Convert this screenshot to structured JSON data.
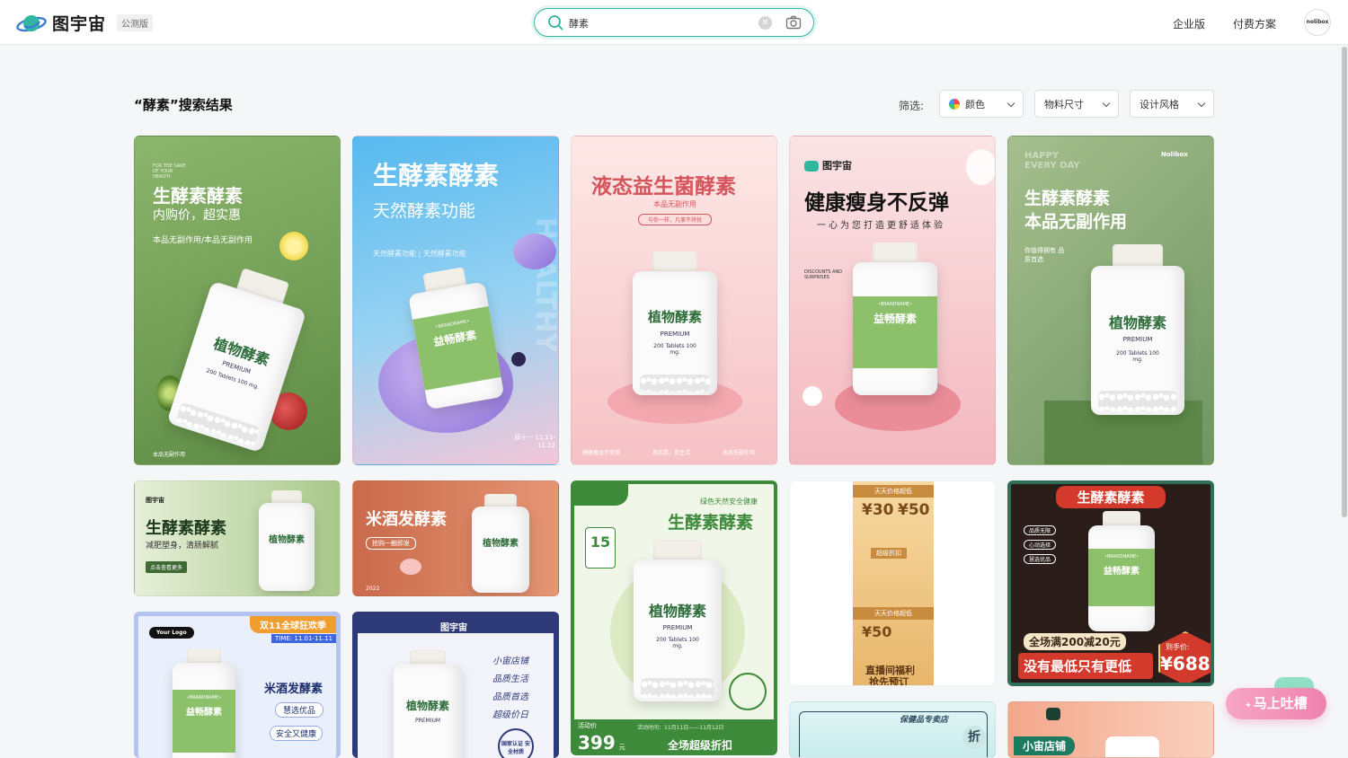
{
  "header": {
    "logo_text": "图宇宙",
    "beta_label": "公测版",
    "search_value": "酵素",
    "nav": [
      "企业版",
      "付费方案"
    ],
    "avatar_text": "nolibox"
  },
  "results": {
    "title": "“酵素”搜索结果",
    "filter_label": "筛选:",
    "filters": [
      "颜色",
      "物料尺寸",
      "设计风格"
    ]
  },
  "feedback_label": "马上吐槽",
  "cards": {
    "c1": {
      "tag": "FOR THE SAKE OF YOUR HEALTH",
      "title": "生酵素酵素",
      "sub": "内购价，超实惠",
      "line": "本品无副作用/本品无副作用",
      "label": "植物酵素",
      "premium": "PREMIUM",
      "tabs": "200 Tablets 100 mg.",
      "footer": "本品无副作用"
    },
    "c2": {
      "title": "生酵素酵素",
      "sub": "天然酵素功能",
      "line": "天然酵素功能 | 天然酵素功能",
      "side": "HEALTHY",
      "brand": "•BRANDNAME•",
      "label": "益畅酵素",
      "date": "双十一 11.11-11.12"
    },
    "c3": {
      "title": "液态益生菌酵素",
      "sub": "本品无副作用",
      "pill": "与你一样，凡事不将就",
      "label": "植物酵素",
      "premium": "PREMIUM",
      "tabs": "200 Tablets 100 mg.",
      "icons": [
        "健康瘦身不反弹",
        "真实惠，真生活",
        "本品无副作用"
      ]
    },
    "c4": {
      "brand": "图宇宙",
      "title": "健康瘦身不反弹",
      "sub": "一心为您打造更舒适体验",
      "tag": "DISCOUNTS AND SURPRISES",
      "brandname": "•BRANDNAME•",
      "label": "益畅酵素"
    },
    "c5": {
      "tag": "HAPPY EVERY DAY",
      "brand": "Nolibox",
      "title": "生酵素酵素",
      "sub": "本品无副作用",
      "line": "你值得拥有 品质首选",
      "label": "植物酵素",
      "premium": "PREMIUM",
      "tabs": "200 Tablets 100 mg."
    },
    "c6": {
      "brand": "图宇宙",
      "title": "生酵素酵素",
      "sub": "减肥塑身，清肠解腻",
      "btn": "点击查看更多",
      "label": "植物酵素"
    },
    "c7": {
      "title": "米酒发酵素",
      "sub": "抢购一触即发",
      "year": "2022",
      "label": "植物酵素"
    },
    "c8": {
      "kicker": "绿色天然安全健康",
      "title": "生酵素酵素",
      "day": "15",
      "price_label": "活动价",
      "price": "399",
      "unit": "元",
      "time": "活动时间：11月11日——11月12日",
      "banner": "全场超级折扣",
      "label": "植物酵素",
      "premium": "PREMIUM",
      "tabs": "200 Tablets 100 mg."
    },
    "c9": {
      "head": "天天价格超低",
      "p1": "30",
      "p2": "50",
      "ribbon": "超级折扣",
      "mid": "天天价格超低",
      "p3": "50",
      "foot1": "直播间福利",
      "foot2": "抢先预订"
    },
    "c10": {
      "title": "生酵素酵素",
      "chips": [
        "品质无限",
        "心动选择",
        "慧选优品"
      ],
      "brand": "•BRANDNAME•",
      "label": "益畅酵素",
      "promo": "全场满200减20元",
      "slogan": "没有最低只有更低",
      "hand": "到手价:",
      "price": "688"
    },
    "c11": {
      "logo": "Your Logo",
      "ribbon": "双11全球狂欢季",
      "time": "TIME: 11.01-11.11",
      "title": "米酒发酵素",
      "chips": [
        "慧选优品",
        "安全又健康"
      ],
      "brand": "•BRANDNAME•",
      "label": "益畅酵素"
    },
    "c12": {
      "brand": "图宇宙",
      "lines": [
        "小宙店铺",
        "品质生活",
        "品质首选",
        "超级价日"
      ],
      "seal": "国家认证 安全材质",
      "label": "植物酵素",
      "premium": "PREMIUM"
    },
    "c13": {
      "title": "保健品专卖店",
      "badge": "折"
    },
    "c14": {
      "title": "小宙店铺"
    }
  }
}
